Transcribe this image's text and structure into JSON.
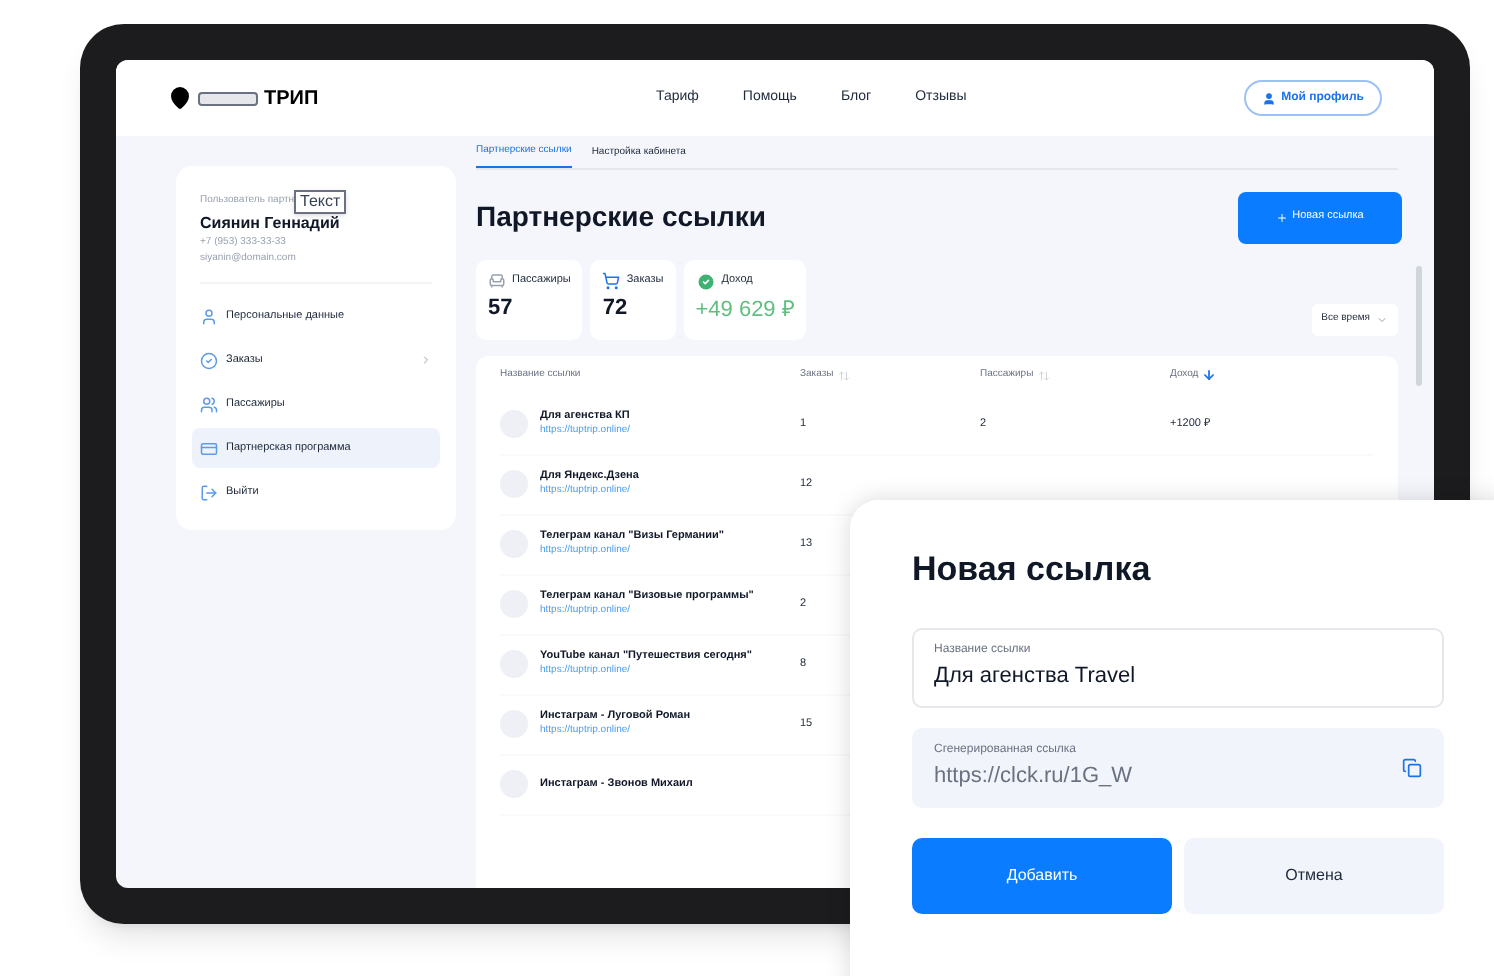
{
  "header": {
    "logo": "ТРИП",
    "nav": [
      "Тариф",
      "Помощь",
      "Блог",
      "Отзывы"
    ],
    "profile_button": "Мой профиль"
  },
  "sidebar": {
    "role": "Пользователь партн",
    "tooltip": "Текст",
    "name": "Сиянин Геннадий",
    "phone": "+7 (953) 333-33-33",
    "email": "siyanin@domain.com",
    "items": [
      {
        "label": "Персональные данные",
        "kind": "user",
        "selected": false,
        "expandable": false
      },
      {
        "label": "Заказы",
        "kind": "orders",
        "selected": false,
        "expandable": true
      },
      {
        "label": "Пассажиры",
        "kind": "passengers",
        "selected": false,
        "expandable": false
      },
      {
        "label": "Партнерская программа",
        "kind": "partner",
        "selected": true,
        "expandable": false
      },
      {
        "label": "Выйти",
        "kind": "logout",
        "selected": false,
        "expandable": false
      }
    ]
  },
  "tabs": [
    {
      "label": "Партнерские ссылки",
      "selected": true
    },
    {
      "label": "Настройка кабинета",
      "selected": false
    }
  ],
  "title": "Партнерские ссылки",
  "new_link_button": "Новая ссылка",
  "stats": [
    {
      "label": "Пассажиры",
      "value": "57",
      "kind": "passengers"
    },
    {
      "label": "Заказы",
      "value": "72",
      "kind": "orders"
    },
    {
      "label": "Доход",
      "value": "+49 629 ₽",
      "kind": "income"
    }
  ],
  "period": "Все время",
  "table": {
    "columns": [
      {
        "label": "Название ссылки"
      },
      {
        "label": "Заказы",
        "sorted": false
      },
      {
        "label": "Пассажиры",
        "sorted": false
      },
      {
        "label": "Доход",
        "sorted": true
      }
    ],
    "rows": [
      {
        "name": "Для агенства КП",
        "url": "https://tuptrip.online/",
        "orders": "1",
        "passengers": "2",
        "income": "+1200 ₽"
      },
      {
        "name": "Для Яндекс.Дзена",
        "url": "https://tuptrip.online/",
        "orders": "12"
      },
      {
        "name": "Телеграм канал \"Визы Германии\"",
        "url": "https://tuptrip.online/",
        "orders": "13"
      },
      {
        "name": "Телеграм канал \"Визовые программы\"",
        "url": "https://tuptrip.online/",
        "orders": "2"
      },
      {
        "name": "YouTube канал \"Путешествия сегодня\"",
        "url": "https://tuptrip.online/",
        "orders": "8"
      },
      {
        "name": "Инстаграм - Луговой Роман",
        "url": "https://tuptrip.online/",
        "orders": "15"
      },
      {
        "name": "Инстаграм - Звонов Михаил"
      }
    ]
  },
  "modal": {
    "title": "Новая ссылка",
    "fields": [
      {
        "label": "Название ссылки",
        "value": "Для агенства Travel",
        "kind": "text"
      },
      {
        "label": "Сгенерированная ссылка",
        "value": "https://clck.ru/1G_W",
        "kind": "copy"
      }
    ],
    "buttons": [
      {
        "label": "Добавить",
        "kind": "primary"
      },
      {
        "label": "Отмена",
        "kind": "secondary"
      }
    ]
  }
}
